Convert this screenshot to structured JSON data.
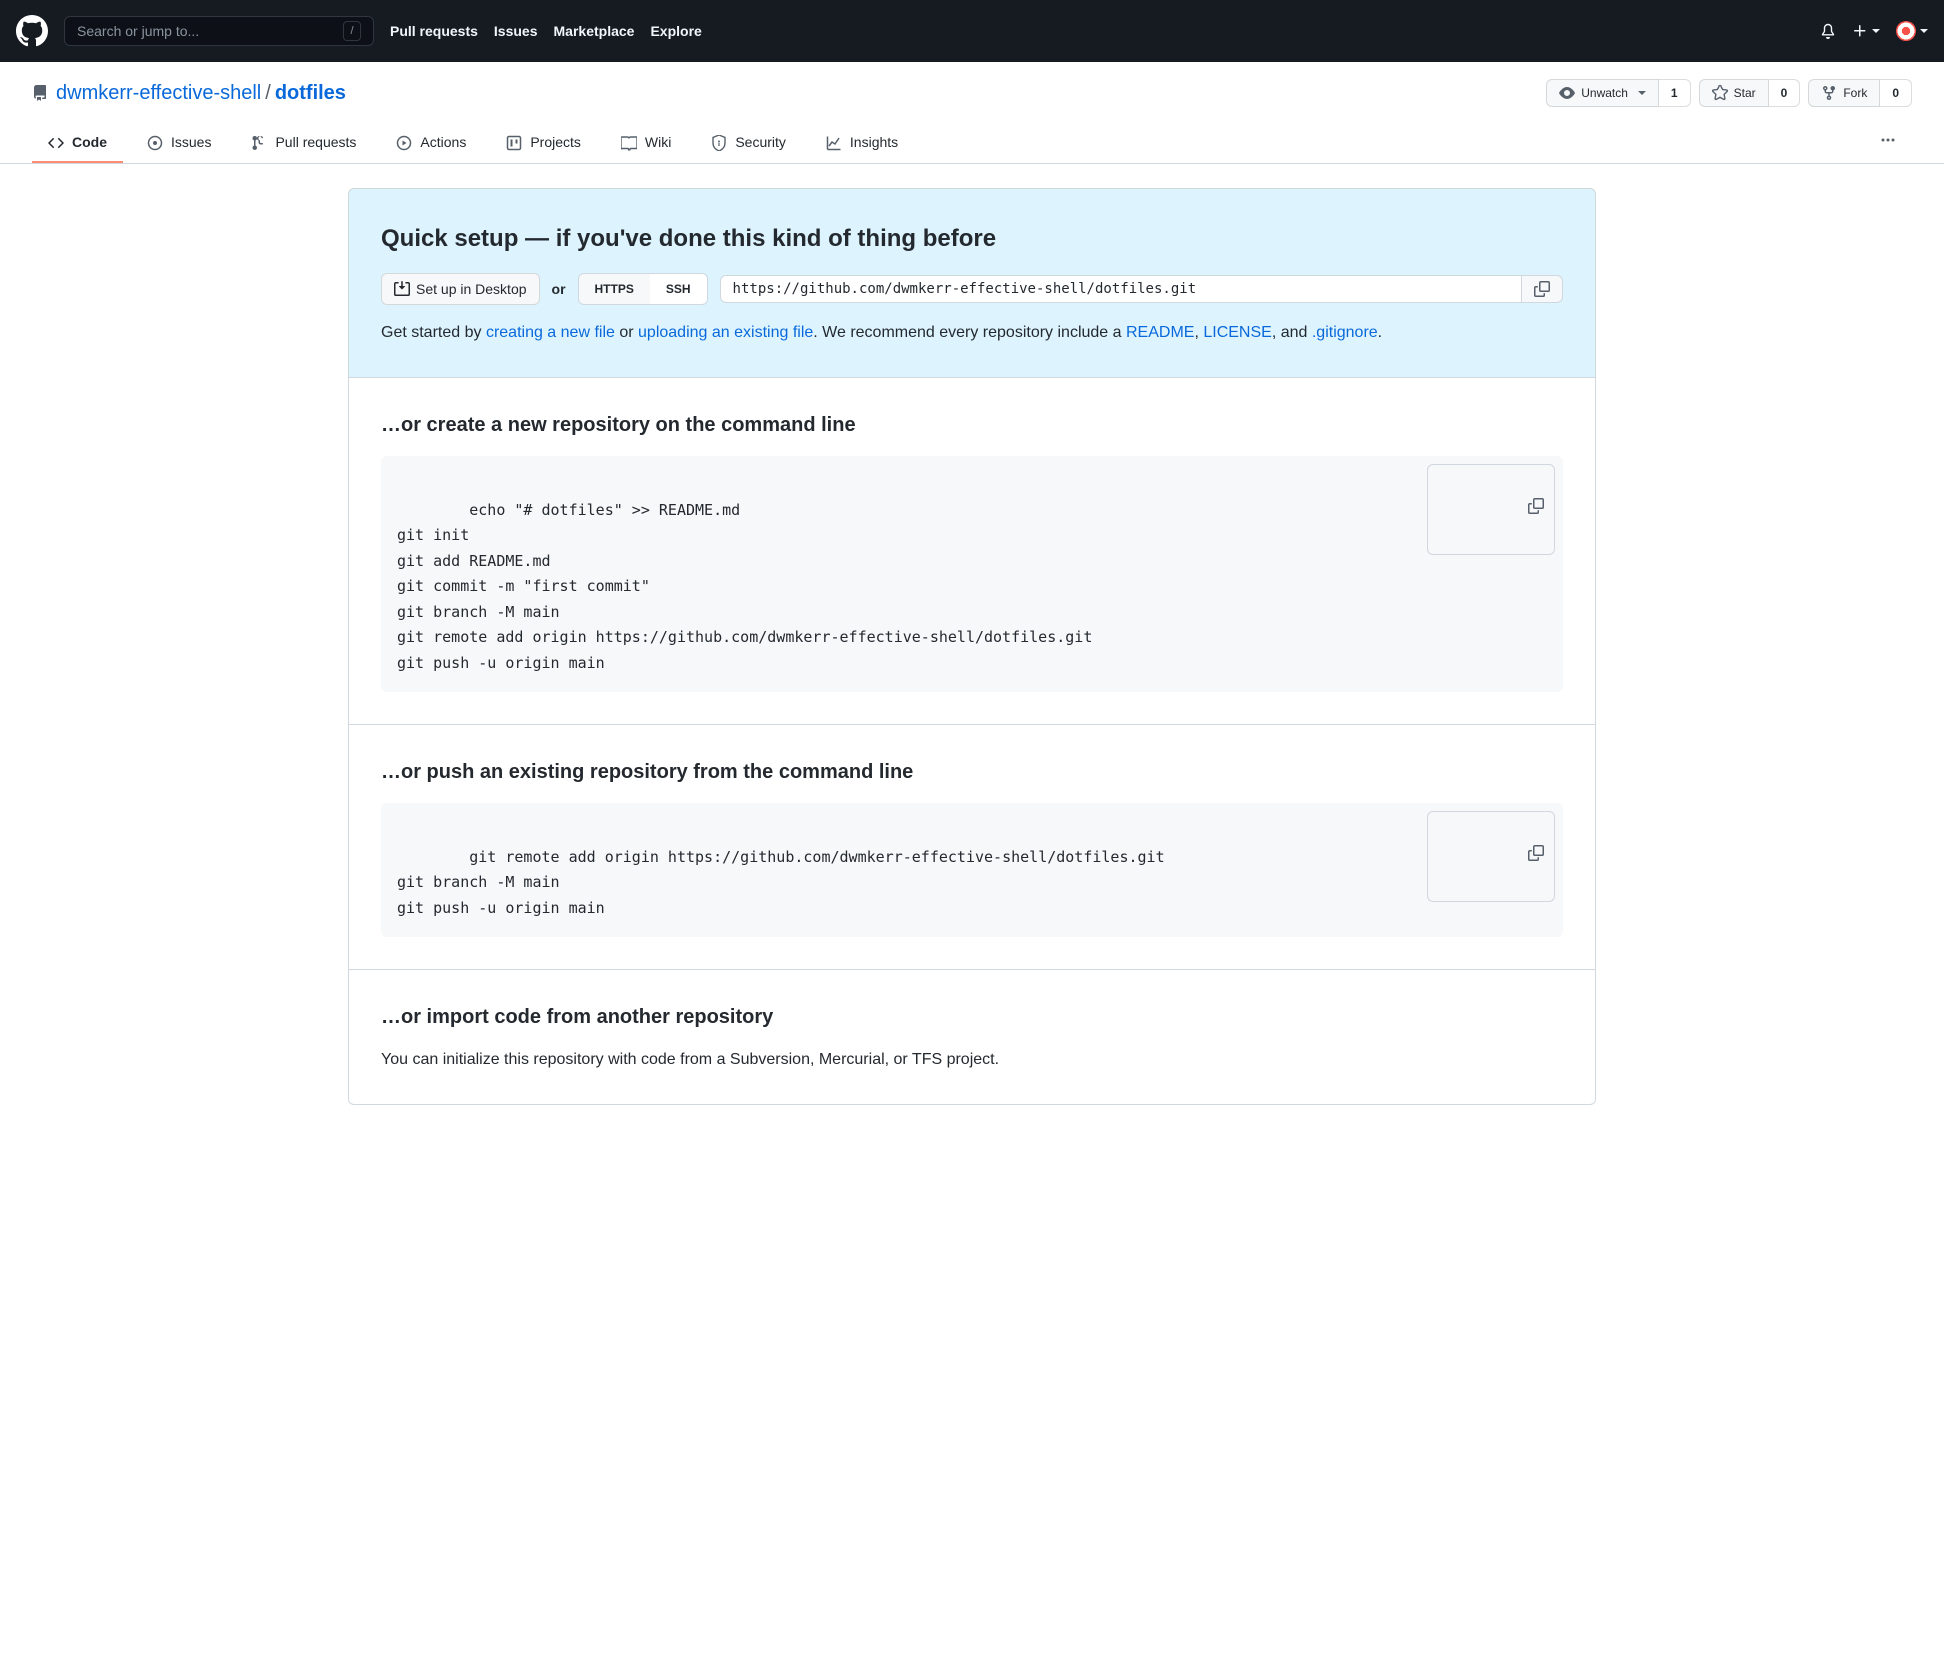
{
  "header": {
    "search_placeholder": "Search or jump to...",
    "slash": "/",
    "nav": {
      "pull_requests": "Pull requests",
      "issues": "Issues",
      "marketplace": "Marketplace",
      "explore": "Explore"
    }
  },
  "repo": {
    "owner": "dwmkerr-effective-shell",
    "name": "dotfiles",
    "separator": "/",
    "actions": {
      "unwatch": {
        "label": "Unwatch",
        "count": "1"
      },
      "star": {
        "label": "Star",
        "count": "0"
      },
      "fork": {
        "label": "Fork",
        "count": "0"
      }
    }
  },
  "tabs": {
    "code": "Code",
    "issues": "Issues",
    "pull_requests": "Pull requests",
    "actions": "Actions",
    "projects": "Projects",
    "wiki": "Wiki",
    "security": "Security",
    "insights": "Insights"
  },
  "quick_setup": {
    "title": "Quick setup — if you've done this kind of thing before",
    "desktop_btn": "Set up in Desktop",
    "or": "or",
    "https": "HTTPS",
    "ssh": "SSH",
    "url": "https://github.com/dwmkerr-effective-shell/dotfiles.git",
    "desc_prefix": "Get started by ",
    "link_new_file": "creating a new file",
    "desc_or": " or ",
    "link_upload": "uploading an existing file",
    "desc_mid": ". We recommend every repository include a ",
    "link_readme": "README",
    "comma": ", ",
    "link_license": "LICENSE",
    "desc_and": ", and ",
    "link_gitignore": ".gitignore",
    "period": "."
  },
  "create_section": {
    "title": "…or create a new repository on the command line",
    "code": "echo \"# dotfiles\" >> README.md\ngit init\ngit add README.md\ngit commit -m \"first commit\"\ngit branch -M main\ngit remote add origin https://github.com/dwmkerr-effective-shell/dotfiles.git\ngit push -u origin main"
  },
  "push_section": {
    "title": "…or push an existing repository from the command line",
    "code": "git remote add origin https://github.com/dwmkerr-effective-shell/dotfiles.git\ngit branch -M main\ngit push -u origin main"
  },
  "import_section": {
    "title": "…or import code from another repository",
    "desc": "You can initialize this repository with code from a Subversion, Mercurial, or TFS project."
  }
}
